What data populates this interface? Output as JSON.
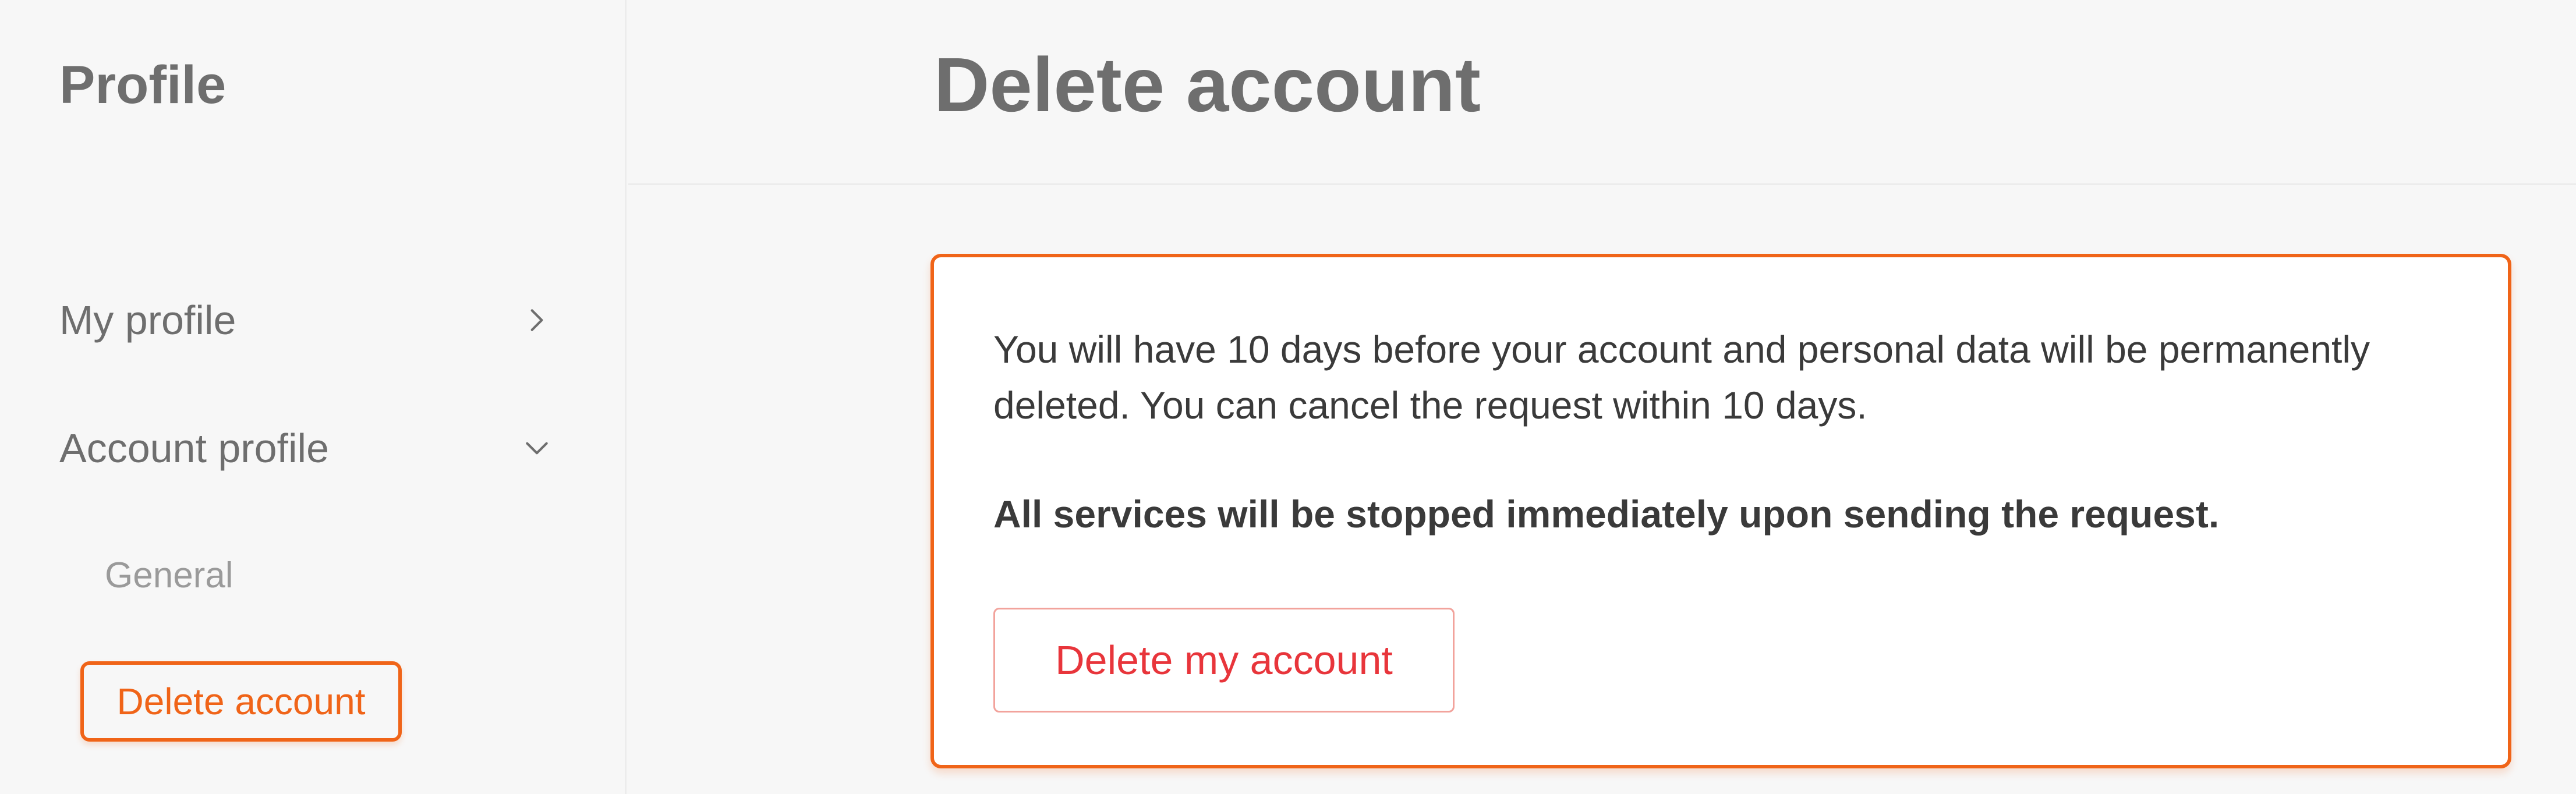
{
  "sidebar": {
    "title": "Profile",
    "items": [
      {
        "label": "My profile",
        "icon": "chevron-right-icon"
      },
      {
        "label": "Account profile",
        "icon": "chevron-down-icon"
      }
    ],
    "sub_items": [
      {
        "label": "General"
      },
      {
        "label": "Delete account",
        "active": true
      }
    ]
  },
  "header": {
    "title": "Delete account"
  },
  "card": {
    "message": "You will have 10 days before your account and personal data will be permanently deleted. You can cancel the request within 10 days.",
    "warning": "All services will be stopped immediately upon sending the request.",
    "button_label": "Delete my account"
  },
  "colors": {
    "accent": "#f06418",
    "danger": "#e8353b",
    "background": "#f7f7f7"
  }
}
